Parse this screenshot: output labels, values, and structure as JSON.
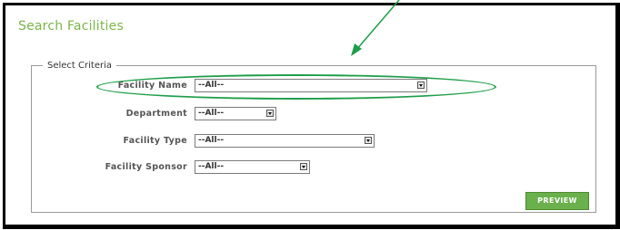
{
  "page_title": "Search Facilities",
  "criteria": {
    "legend": "Select Criteria",
    "fields": [
      {
        "label": "Facility Name",
        "value": "--All--"
      },
      {
        "label": "Department",
        "value": "--All--"
      },
      {
        "label": "Facility Type",
        "value": "--All--"
      },
      {
        "label": "Facility Sponsor",
        "value": "--All--"
      }
    ]
  },
  "preview_button": "PREVIEW",
  "annotation_color": "#1e9e4a",
  "accent_color": "#7ab648"
}
